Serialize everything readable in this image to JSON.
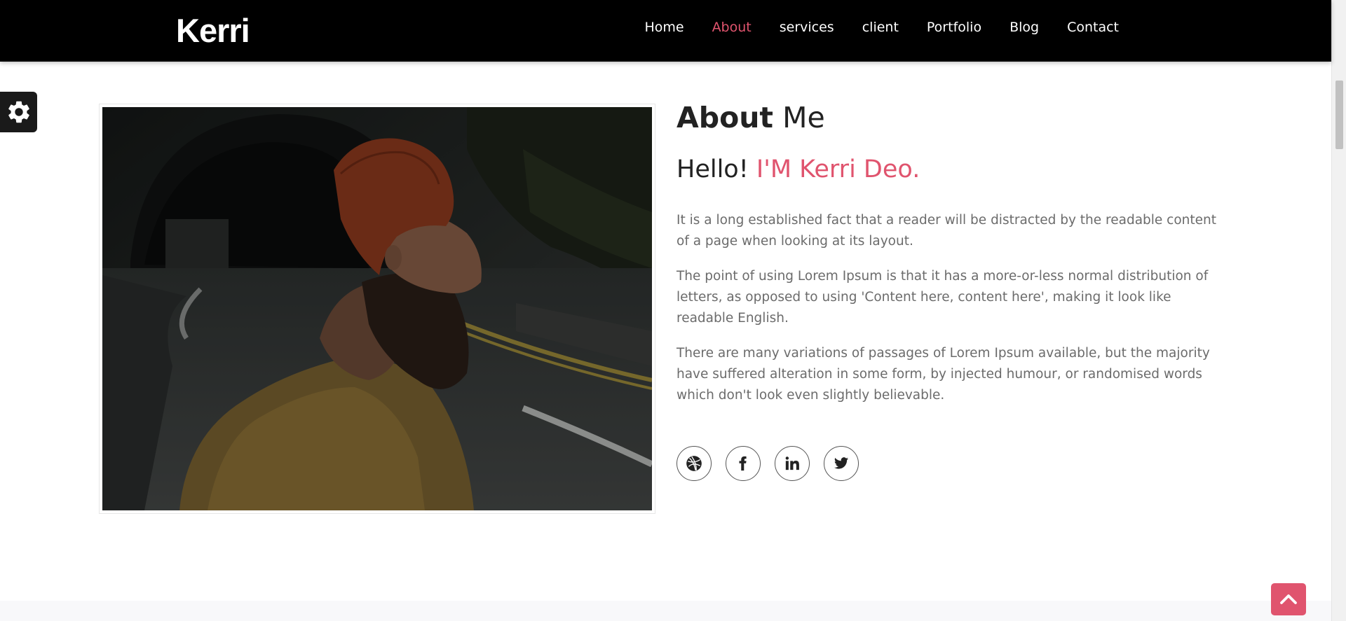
{
  "nav": {
    "brand": "Kerri",
    "items": [
      {
        "label": "Home",
        "active": false
      },
      {
        "label": "About",
        "active": true
      },
      {
        "label": "services",
        "active": false
      },
      {
        "label": "client",
        "active": false
      },
      {
        "label": "Portfolio",
        "active": false
      },
      {
        "label": "Blog",
        "active": false
      },
      {
        "label": "Contact",
        "active": false
      }
    ]
  },
  "about": {
    "title_bold": "About",
    "title_rest": "Me",
    "hello": "Hello!",
    "name": "I'M Kerri Deo.",
    "paragraphs": [
      "It is a long established fact that a reader will be distracted by the readable content of a page when looking at its layout.",
      "The point of using Lorem Ipsum is that it has a more-or-less normal distribution of letters, as opposed to using 'Content here, content here', making it look like readable English.",
      "There are many variations of passages of Lorem Ipsum available, but the majority have suffered alteration in some form, by injected humour, or randomised words which don't look even slightly believable."
    ]
  },
  "socials": [
    {
      "icon": "dribbble-icon"
    },
    {
      "icon": "facebook-icon"
    },
    {
      "icon": "linkedin-icon"
    },
    {
      "icon": "twitter-icon"
    }
  ],
  "colors": {
    "accent": "#e0546e",
    "nav_bg": "#000000",
    "text_muted": "#6b6b6b"
  }
}
